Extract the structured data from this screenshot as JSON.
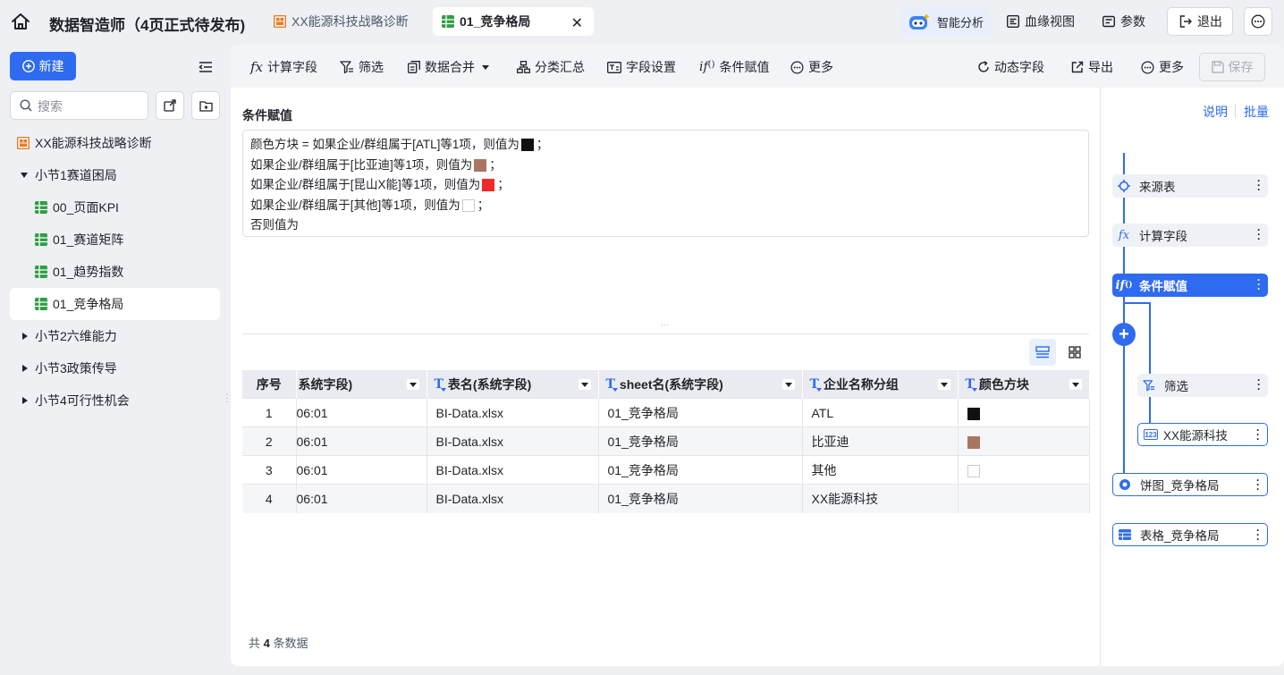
{
  "app": {
    "title": "数据智造师（4页正式待发布)",
    "tabs": [
      {
        "label": "XX能源科技战略诊断"
      },
      {
        "label": "01_竞争格局"
      }
    ],
    "close_glyph": "✕"
  },
  "topbar": {
    "ai_label": "智能分析",
    "lineage_label": "血缘视图",
    "param_label": "参数",
    "exit_label": "退出"
  },
  "sidebar": {
    "new_label": "新建",
    "search_placeholder": "搜索",
    "root": "XX能源科技战略诊断",
    "sections": [
      {
        "label": "小节1赛道困局",
        "expanded": true
      },
      {
        "label": "小节2六维能力",
        "expanded": false
      },
      {
        "label": "小节3政策传导",
        "expanded": false
      },
      {
        "label": "小节4可行性机会",
        "expanded": false
      }
    ],
    "pages": [
      {
        "label": "00_页面KPI"
      },
      {
        "label": "01_赛道矩阵"
      },
      {
        "label": "01_趋势指数"
      },
      {
        "label": "01_竞争格局",
        "active": true
      }
    ]
  },
  "toolbar": {
    "calc_field": "计算字段",
    "filter": "筛选",
    "data_merge": "数据合并",
    "group_summary": "分类汇总",
    "field_settings": "字段设置",
    "conditional_assign": "条件赋值",
    "more": "更多",
    "dynamic_field": "动态字段",
    "export": "导出",
    "more_right": "更多",
    "save": "保存"
  },
  "editor": {
    "section_title": "条件赋值",
    "formula_lines": [
      {
        "text": "颜色方块 = 如果企业/群组属于[ATL]等1项，则值为",
        "swatch": "#111111",
        "tail": "；"
      },
      {
        "text": "如果企业/群组属于[比亚迪]等1项，则值为",
        "swatch": "#a87763",
        "tail": "；"
      },
      {
        "text": "如果企业/群组属于[昆山X能]等1项，则值为",
        "swatch": "#ee2a2a",
        "tail": "；"
      },
      {
        "text": "如果企业/群组属于[其他]等1项，则值为",
        "swatch": "#ffffff",
        "tail": "；"
      },
      {
        "text": "否则值为",
        "swatch": null,
        "tail": ""
      }
    ],
    "divider_dots": "···"
  },
  "table": {
    "columns": [
      {
        "label": "序号",
        "typed": false
      },
      {
        "label": "系统字段)",
        "typed": false
      },
      {
        "label": "表名(系统字段)",
        "typed": true
      },
      {
        "label": "sheet名(系统字段)",
        "typed": true
      },
      {
        "label": "企业名称分组",
        "typed": true
      },
      {
        "label": "颜色方块",
        "typed": true
      }
    ],
    "type_glyph": "T",
    "rows": [
      {
        "idx": "1",
        "time": "06:01",
        "table": "BI-Data.xlsx",
        "sheet": "01_竞争格局",
        "group": "ATL",
        "color": "#111111"
      },
      {
        "idx": "2",
        "time": "06:01",
        "table": "BI-Data.xlsx",
        "sheet": "01_竞争格局",
        "group": "比亚迪",
        "color": "#a87763"
      },
      {
        "idx": "3",
        "time": "06:01",
        "table": "BI-Data.xlsx",
        "sheet": "01_竞争格局",
        "group": "其他",
        "color": "#ffffff"
      },
      {
        "idx": "4",
        "time": "06:01",
        "table": "BI-Data.xlsx",
        "sheet": "01_竞争格局",
        "group": "XX能源科技",
        "color": null
      }
    ],
    "footer_prefix": "共",
    "footer_count": "4",
    "footer_suffix": "条数据"
  },
  "flow": {
    "help_link": "说明",
    "batch_link": "批量",
    "nodes": [
      {
        "label": "来源表"
      },
      {
        "label": "计算字段"
      },
      {
        "label": "条件赋值"
      },
      {
        "label": "筛选"
      },
      {
        "label": "XX能源科技"
      },
      {
        "label": "饼图_竞争格局"
      },
      {
        "label": "表格_竞争格局"
      }
    ],
    "plus_glyph": "+"
  },
  "colors": {
    "accent": "#2f6bf0",
    "brand_orange": "#f07a1a",
    "sheet_green": "#2f9e44"
  }
}
